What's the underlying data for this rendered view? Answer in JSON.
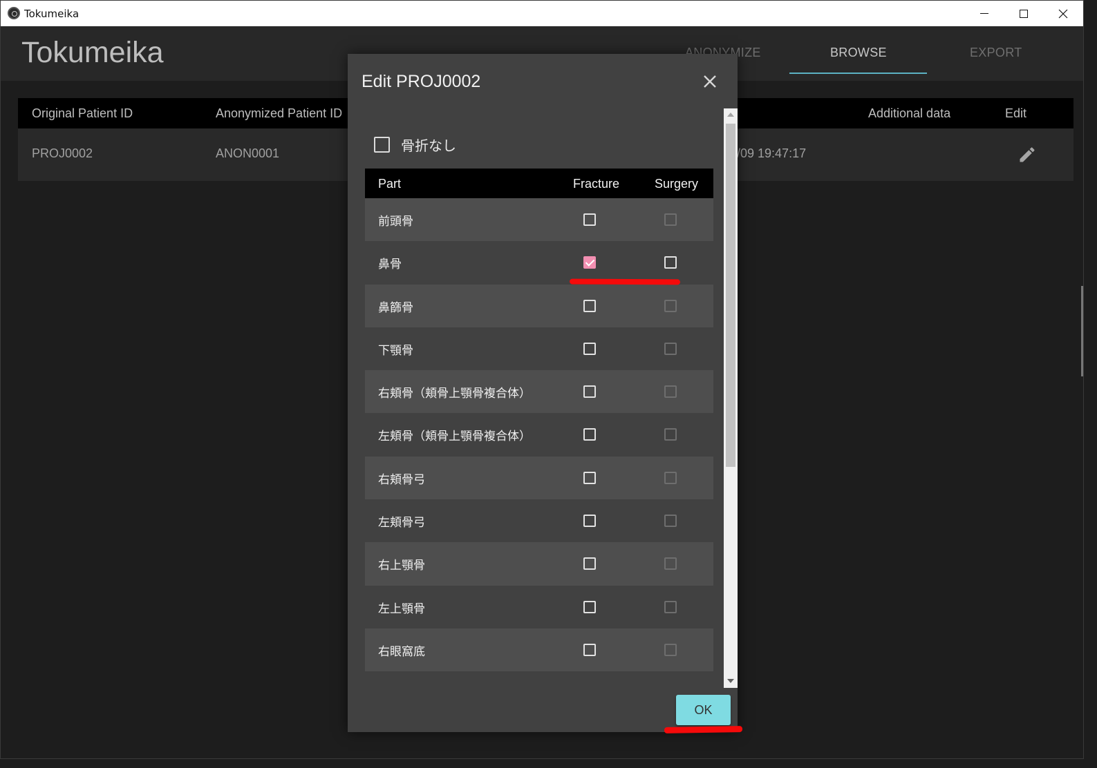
{
  "window": {
    "title": "Tokumeika"
  },
  "header": {
    "brand": "Tokumeika",
    "tabs": [
      {
        "label": "ANONYMIZE",
        "active": false
      },
      {
        "label": "BROWSE",
        "active": true
      },
      {
        "label": "EXPORT",
        "active": false
      }
    ]
  },
  "table": {
    "columns": [
      "Original Patient ID",
      "Anonymized Patient ID",
      "Additional data",
      "Edit"
    ],
    "row": {
      "original_id": "PROJ0002",
      "anonymized_id": "ANON0001",
      "timestamp": "/09 19:47:17"
    }
  },
  "dialog": {
    "title": "Edit PROJ0002",
    "no_fracture_label": "骨折なし",
    "columns": {
      "part": "Part",
      "fracture": "Fracture",
      "surgery": "Surgery"
    },
    "rows": [
      {
        "part": "前頭骨",
        "fracture": false,
        "surgery": false,
        "surgery_enabled": false
      },
      {
        "part": "鼻骨",
        "fracture": true,
        "surgery": false,
        "surgery_enabled": true
      },
      {
        "part": "鼻篩骨",
        "fracture": false,
        "surgery": false,
        "surgery_enabled": false
      },
      {
        "part": "下顎骨",
        "fracture": false,
        "surgery": false,
        "surgery_enabled": false
      },
      {
        "part": "右頬骨（頬骨上顎骨複合体）",
        "fracture": false,
        "surgery": false,
        "surgery_enabled": false
      },
      {
        "part": "左頬骨（頬骨上顎骨複合体）",
        "fracture": false,
        "surgery": false,
        "surgery_enabled": false
      },
      {
        "part": "右頬骨弓",
        "fracture": false,
        "surgery": false,
        "surgery_enabled": false
      },
      {
        "part": "左頬骨弓",
        "fracture": false,
        "surgery": false,
        "surgery_enabled": false
      },
      {
        "part": "右上顎骨",
        "fracture": false,
        "surgery": false,
        "surgery_enabled": false
      },
      {
        "part": "左上顎骨",
        "fracture": false,
        "surgery": false,
        "surgery_enabled": false
      },
      {
        "part": "右眼窩底",
        "fracture": false,
        "surgery": false,
        "surgery_enabled": false
      }
    ],
    "ok_label": "OK"
  },
  "colors": {
    "accent": "#7fdbe2",
    "checked": "#f28fb1",
    "annotation": "#f50a0a",
    "tab_indicator": "#5cb3c4"
  },
  "icons": {
    "app": "app-logo-icon",
    "edit": "pencil-icon",
    "close": "close-icon"
  }
}
